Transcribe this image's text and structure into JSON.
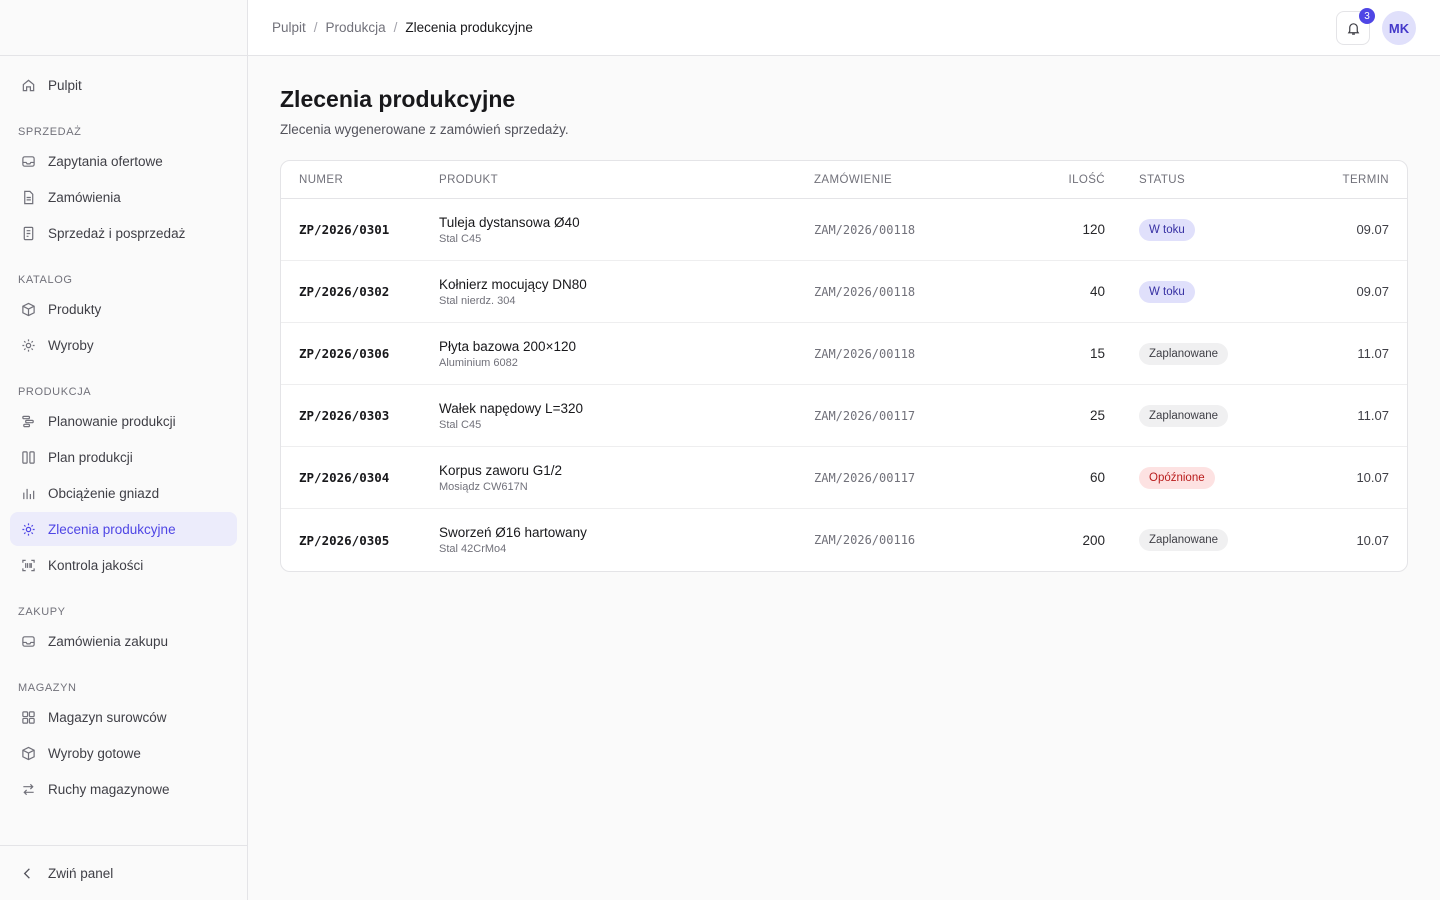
{
  "sidebar": {
    "top_item": {
      "label": "Pulpit",
      "icon": "home-icon"
    },
    "sections": [
      {
        "label": "SPRZEDAŻ",
        "items": [
          {
            "label": "Zapytania ofertowe",
            "icon": "inbox-icon"
          },
          {
            "label": "Zamówienia",
            "icon": "document-icon"
          },
          {
            "label": "Sprzedaż i posprzedaż",
            "icon": "receipt-icon"
          }
        ]
      },
      {
        "label": "KATALOG",
        "items": [
          {
            "label": "Produkty",
            "icon": "box-icon"
          },
          {
            "label": "Wyroby",
            "icon": "gear-icon"
          }
        ]
      },
      {
        "label": "PRODUKCJA",
        "items": [
          {
            "label": "Planowanie produkcji",
            "icon": "gantt-icon"
          },
          {
            "label": "Plan produkcji",
            "icon": "columns-icon"
          },
          {
            "label": "Obciążenie gniazd",
            "icon": "bar-chart-icon"
          },
          {
            "label": "Zlecenia produkcyjne",
            "icon": "gear-icon",
            "active": true
          },
          {
            "label": "Kontrola jakości",
            "icon": "scan-icon"
          }
        ]
      },
      {
        "label": "ZAKUPY",
        "items": [
          {
            "label": "Zamówienia zakupu",
            "icon": "inbox-icon"
          }
        ]
      },
      {
        "label": "MAGAZYN",
        "items": [
          {
            "label": "Magazyn surowców",
            "icon": "grid-icon"
          },
          {
            "label": "Wyroby gotowe",
            "icon": "box-icon"
          },
          {
            "label": "Ruchy magazynowe",
            "icon": "arrows-icon"
          }
        ]
      }
    ],
    "collapse_label": "Zwiń panel"
  },
  "header": {
    "breadcrumb": [
      "Pulpit",
      "Produkcja",
      "Zlecenia produkcyjne"
    ],
    "notification_count": "3",
    "avatar_initials": "MK"
  },
  "page": {
    "title": "Zlecenia produkcyjne",
    "subtitle": "Zlecenia wygenerowane z zamówień sprzedaży."
  },
  "table": {
    "columns": {
      "number": "NUMER",
      "product": "PRODUKT",
      "order": "ZAMÓWIENIE",
      "quantity": "ILOŚĆ",
      "status": "STATUS",
      "deadline": "TERMIN"
    },
    "rows": [
      {
        "number": "ZP/2026/0301",
        "product": "Tuleja dystansowa Ø40",
        "material": "Stal C45",
        "order": "ZAM/2026/00118",
        "quantity": "120",
        "status": "W toku",
        "status_type": "progress",
        "deadline": "09.07"
      },
      {
        "number": "ZP/2026/0302",
        "product": "Kołnierz mocujący DN80",
        "material": "Stal nierdz. 304",
        "order": "ZAM/2026/00118",
        "quantity": "40",
        "status": "W toku",
        "status_type": "progress",
        "deadline": "09.07"
      },
      {
        "number": "ZP/2026/0306",
        "product": "Płyta bazowa 200×120",
        "material": "Aluminium 6082",
        "order": "ZAM/2026/00118",
        "quantity": "15",
        "status": "Zaplanowane",
        "status_type": "planned",
        "deadline": "11.07"
      },
      {
        "number": "ZP/2026/0303",
        "product": "Wałek napędowy L=320",
        "material": "Stal C45",
        "order": "ZAM/2026/00117",
        "quantity": "25",
        "status": "Zaplanowane",
        "status_type": "planned",
        "deadline": "11.07"
      },
      {
        "number": "ZP/2026/0304",
        "product": "Korpus zaworu G1/2",
        "material": "Mosiądz CW617N",
        "order": "ZAM/2026/00117",
        "quantity": "60",
        "status": "Opóźnione",
        "status_type": "late",
        "deadline": "10.07"
      },
      {
        "number": "ZP/2026/0305",
        "product": "Sworzeń Ø16 hartowany",
        "material": "Stal 42CrMo4",
        "order": "ZAM/2026/00116",
        "quantity": "200",
        "status": "Zaplanowane",
        "status_type": "planned",
        "deadline": "10.07"
      }
    ]
  },
  "colors": {
    "accent": "#4f46e5",
    "active_bg": "#ececfb",
    "late_bg": "#fde2e2",
    "late_text": "#b91c1c"
  }
}
